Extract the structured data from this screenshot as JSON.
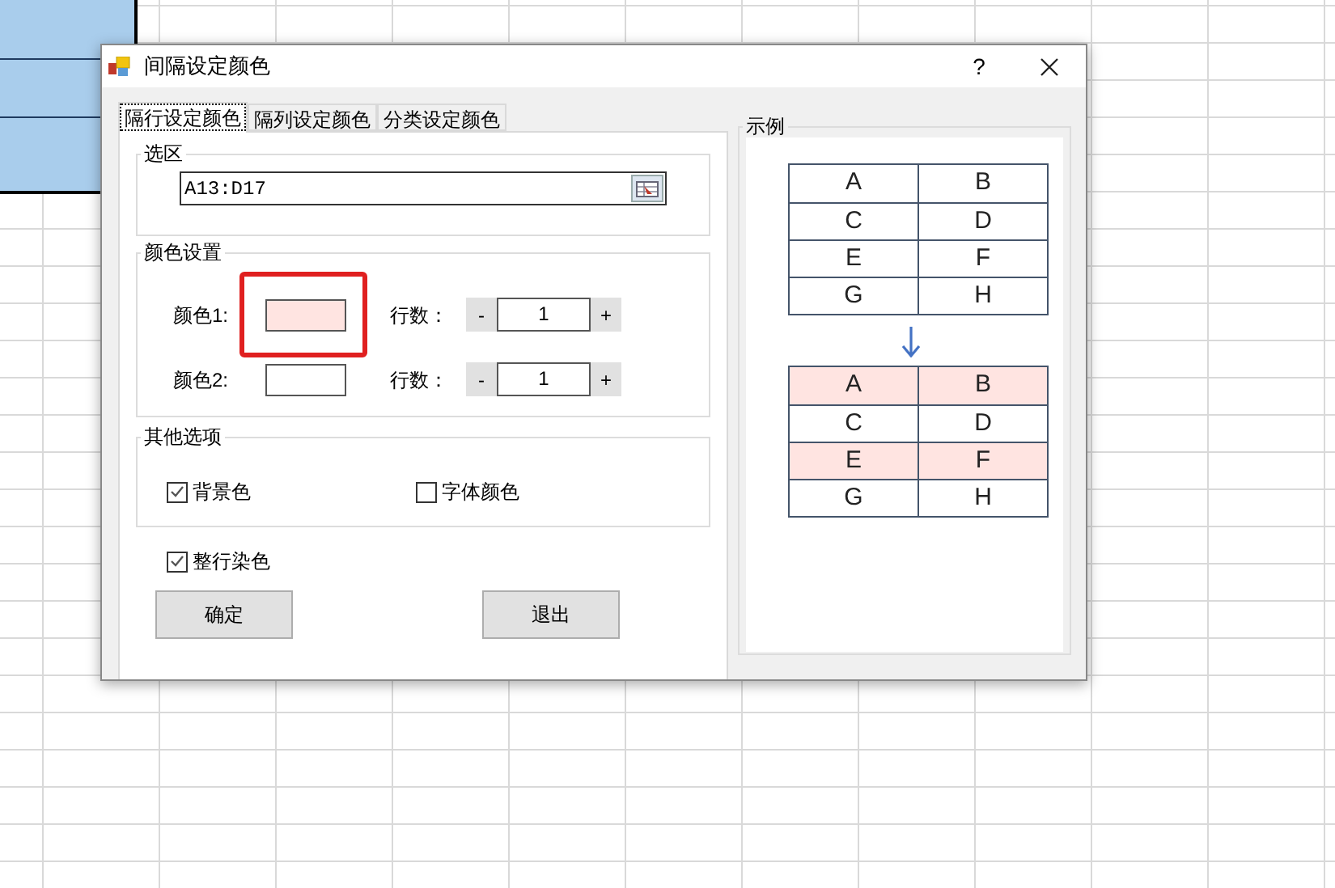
{
  "window": {
    "title": "间隔设定颜色",
    "help": "?"
  },
  "tabs": [
    {
      "label": "隔行设定颜色",
      "selected": true
    },
    {
      "label": "隔列设定颜色",
      "selected": false
    },
    {
      "label": "分类设定颜色",
      "selected": false
    }
  ],
  "selection_group": {
    "title": "选区",
    "range": "A13:D17"
  },
  "color_group": {
    "title": "颜色设置",
    "rows": [
      {
        "label": "颜色1:",
        "color": "#ffe4e1",
        "highlighted": true,
        "count_label": "行数：",
        "minus": "-",
        "count": "1",
        "plus": "+"
      },
      {
        "label": "颜色2:",
        "color": "#ffffff",
        "highlighted": false,
        "count_label": "行数：",
        "minus": "-",
        "count": "1",
        "plus": "+"
      }
    ]
  },
  "other_options": {
    "title": "其他选项",
    "checkboxes": [
      {
        "label": "背景色",
        "checked": true
      },
      {
        "label": "字体颜色",
        "checked": false
      }
    ]
  },
  "whole_row": {
    "label": "整行染色",
    "checked": true
  },
  "buttons": [
    "确定",
    "退出"
  ],
  "example": {
    "title": "示例",
    "before": [
      {
        "cells": [
          "A",
          "B"
        ],
        "shaded": false
      },
      {
        "cells": [
          "C",
          "D"
        ],
        "shaded": false
      },
      {
        "cells": [
          "E",
          "F"
        ],
        "shaded": false
      },
      {
        "cells": [
          "G",
          "H"
        ],
        "shaded": false
      }
    ],
    "after": [
      {
        "cells": [
          "A",
          "B"
        ],
        "shaded": true
      },
      {
        "cells": [
          "C",
          "D"
        ],
        "shaded": false
      },
      {
        "cells": [
          "E",
          "F"
        ],
        "shaded": true
      },
      {
        "cells": [
          "G",
          "H"
        ],
        "shaded": false
      }
    ]
  }
}
